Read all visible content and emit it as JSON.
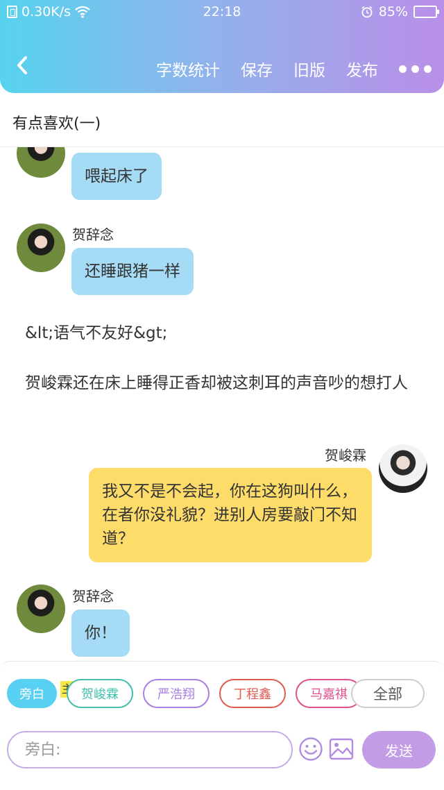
{
  "status_bar": {
    "network_speed": "0.30K/s",
    "time": "22:18",
    "battery_percent": "85%"
  },
  "nav": {
    "back_icon": "chevron-left-icon",
    "word_count": "字数统计",
    "save": "保存",
    "old_version": "旧版",
    "publish": "发布",
    "more_icon": "more-dots-icon"
  },
  "title": "有点喜欢(一)",
  "messages": [
    {
      "type": "bubble",
      "side": "left",
      "speaker": "",
      "text": "喂起床了"
    },
    {
      "type": "bubble",
      "side": "left",
      "speaker": "贺辞念",
      "text": "还睡跟猪一样"
    },
    {
      "type": "narration",
      "text": "&lt;语气不友好&gt;"
    },
    {
      "type": "narration",
      "text": "贺峻霖还在床上睡得正香却被这刺耳的声音吵的想打人"
    },
    {
      "type": "bubble",
      "side": "right",
      "speaker": "贺峻霖",
      "text": "我又不是不会起，你在这狗叫什么，在者你没礼貌？进别人房要敲门不知道？"
    },
    {
      "type": "bubble",
      "side": "left",
      "speaker": "贺辞念",
      "text": "你！"
    }
  ],
  "roles": {
    "narrator": "旁白",
    "main_badge": "主",
    "chips": [
      {
        "label": "贺峻霖",
        "color": "#3fbfaa"
      },
      {
        "label": "严浩翔",
        "color": "#a77fe0"
      },
      {
        "label": "丁程鑫",
        "color": "#e05a4f"
      },
      {
        "label": "马嘉祺",
        "color": "#e0508a"
      }
    ],
    "all": "全部"
  },
  "composer": {
    "placeholder": "旁白:",
    "send": "发送",
    "emoji_icon": "smiley-icon",
    "image_icon": "image-icon"
  },
  "colors": {
    "header_gradient_start": "#56d3ee",
    "header_gradient_end": "#b98fe8",
    "bubble_left": "#a6dbf6",
    "bubble_right": "#fddc69",
    "send_button": "#c29de6"
  }
}
